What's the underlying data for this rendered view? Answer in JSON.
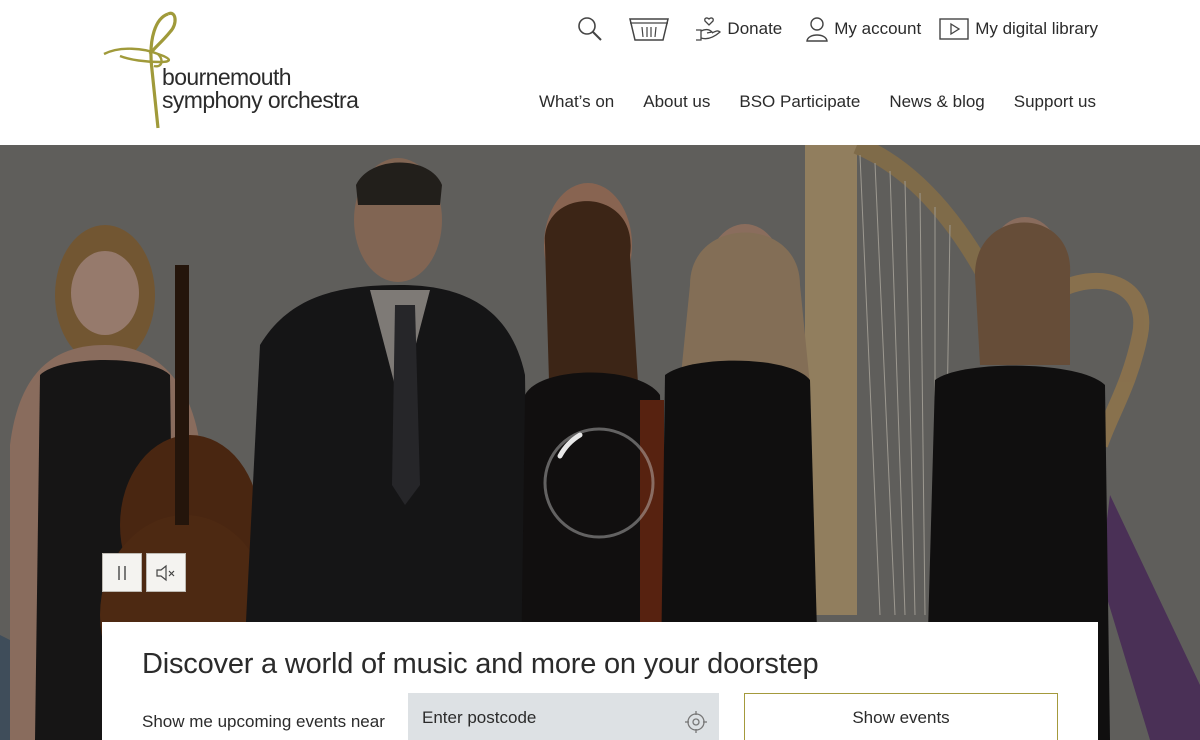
{
  "logo": {
    "line1": "bournemouth",
    "line2": "symphony orchestra"
  },
  "utility_nav": {
    "search_icon": "search-icon",
    "basket_icon": "basket-icon",
    "donate": "Donate",
    "account": "My account",
    "library": "My digital library"
  },
  "main_nav": {
    "items": [
      "What’s on",
      "About us",
      "BSO Participate",
      "News & blog",
      "Support us"
    ]
  },
  "hero": {
    "controls": {
      "pause_icon": "pause-icon",
      "mute_icon": "mute-icon"
    },
    "loading_icon": "loading-spinner-icon"
  },
  "event_search": {
    "title": "Discover a world of music and more on your doorstep",
    "label": "Show me upcoming events near",
    "postcode_placeholder": "Enter postcode",
    "locate_icon": "crosshair-icon",
    "button": "Show events"
  },
  "colors": {
    "brand_olive": "#a49a3c",
    "input_bg": "#dde1e4",
    "text": "#2b2b2b"
  }
}
